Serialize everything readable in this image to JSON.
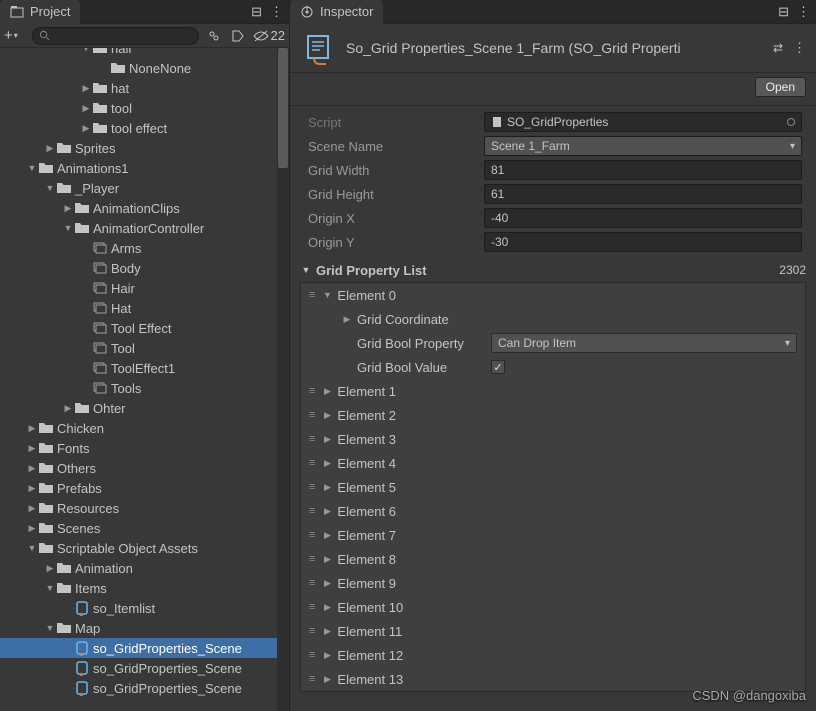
{
  "projectPanel": {
    "tabLabel": "Project",
    "search": {
      "placeholder": ""
    },
    "visibilityCount": "22",
    "tree": [
      {
        "depth": 4,
        "arrow": "down",
        "iconType": "folder",
        "label": "hair",
        "cut": true
      },
      {
        "depth": 5,
        "arrow": "",
        "iconType": "folder",
        "label": "NoneNone"
      },
      {
        "depth": 4,
        "arrow": "right",
        "iconType": "folder",
        "label": "hat"
      },
      {
        "depth": 4,
        "arrow": "right",
        "iconType": "folder",
        "label": "tool"
      },
      {
        "depth": 4,
        "arrow": "right",
        "iconType": "folder",
        "label": "tool effect"
      },
      {
        "depth": 2,
        "arrow": "right",
        "iconType": "folder",
        "label": "Sprites"
      },
      {
        "depth": 1,
        "arrow": "down",
        "iconType": "folder",
        "label": "Animations1"
      },
      {
        "depth": 2,
        "arrow": "down",
        "iconType": "folder",
        "label": "_Player"
      },
      {
        "depth": 3,
        "arrow": "right",
        "iconType": "folder",
        "label": "AnimationClips"
      },
      {
        "depth": 3,
        "arrow": "down",
        "iconType": "folder",
        "label": "AnimatiorController"
      },
      {
        "depth": 4,
        "arrow": "",
        "iconType": "anim",
        "label": "Arms"
      },
      {
        "depth": 4,
        "arrow": "",
        "iconType": "anim",
        "label": "Body"
      },
      {
        "depth": 4,
        "arrow": "",
        "iconType": "anim",
        "label": "Hair"
      },
      {
        "depth": 4,
        "arrow": "",
        "iconType": "anim",
        "label": "Hat"
      },
      {
        "depth": 4,
        "arrow": "",
        "iconType": "anim",
        "label": "Tool Effect"
      },
      {
        "depth": 4,
        "arrow": "",
        "iconType": "anim",
        "label": "Tool"
      },
      {
        "depth": 4,
        "arrow": "",
        "iconType": "anim",
        "label": "ToolEffect1"
      },
      {
        "depth": 4,
        "arrow": "",
        "iconType": "anim",
        "label": "Tools"
      },
      {
        "depth": 3,
        "arrow": "right",
        "iconType": "folder",
        "label": "Ohter"
      },
      {
        "depth": 1,
        "arrow": "right",
        "iconType": "folder",
        "label": "Chicken"
      },
      {
        "depth": 1,
        "arrow": "right",
        "iconType": "folder",
        "label": "Fonts"
      },
      {
        "depth": 1,
        "arrow": "right",
        "iconType": "folder",
        "label": "Others"
      },
      {
        "depth": 1,
        "arrow": "right",
        "iconType": "folder",
        "label": "Prefabs"
      },
      {
        "depth": 1,
        "arrow": "right",
        "iconType": "folder",
        "label": "Resources"
      },
      {
        "depth": 1,
        "arrow": "right",
        "iconType": "folder",
        "label": "Scenes"
      },
      {
        "depth": 1,
        "arrow": "down",
        "iconType": "folder",
        "label": "Scriptable Object Assets"
      },
      {
        "depth": 2,
        "arrow": "right",
        "iconType": "folder",
        "label": "Animation"
      },
      {
        "depth": 2,
        "arrow": "down",
        "iconType": "folder",
        "label": "Items"
      },
      {
        "depth": 3,
        "arrow": "",
        "iconType": "so",
        "label": "so_Itemlist"
      },
      {
        "depth": 2,
        "arrow": "down",
        "iconType": "folder",
        "label": "Map"
      },
      {
        "depth": 3,
        "arrow": "",
        "iconType": "so",
        "label": "so_GridProperties_Scene",
        "selected": true
      },
      {
        "depth": 3,
        "arrow": "",
        "iconType": "so",
        "label": "so_GridProperties_Scene"
      },
      {
        "depth": 3,
        "arrow": "",
        "iconType": "so",
        "label": "so_GridProperties_Scene"
      }
    ]
  },
  "inspectorPanel": {
    "tabLabel": "Inspector",
    "assetTitle": "So_Grid Properties_Scene 1_Farm (SO_Grid Properti",
    "openLabel": "Open",
    "properties": {
      "scriptLabel": "Script",
      "scriptValue": "SO_GridProperties",
      "sceneNameLabel": "Scene Name",
      "sceneNameValue": "Scene 1_Farm",
      "gridWidthLabel": "Grid Width",
      "gridWidthValue": "81",
      "gridHeightLabel": "Grid Height",
      "gridHeightValue": "61",
      "originXLabel": "Origin X",
      "originXValue": "-40",
      "originYLabel": "Origin Y",
      "originYValue": "-30"
    },
    "listHeader": "Grid Property List",
    "listCount": "2302",
    "element0": {
      "label": "Element 0",
      "gridCoordLabel": "Grid Coordinate",
      "boolPropLabel": "Grid Bool Property",
      "boolPropValue": "Can Drop Item",
      "boolValueLabel": "Grid Bool Value",
      "boolValueChecked": true
    },
    "elements": [
      "Element 1",
      "Element 2",
      "Element 3",
      "Element 4",
      "Element 5",
      "Element 6",
      "Element 7",
      "Element 8",
      "Element 9",
      "Element 10",
      "Element 11",
      "Element 12",
      "Element 13"
    ]
  },
  "watermark": "CSDN @dangoxiba"
}
